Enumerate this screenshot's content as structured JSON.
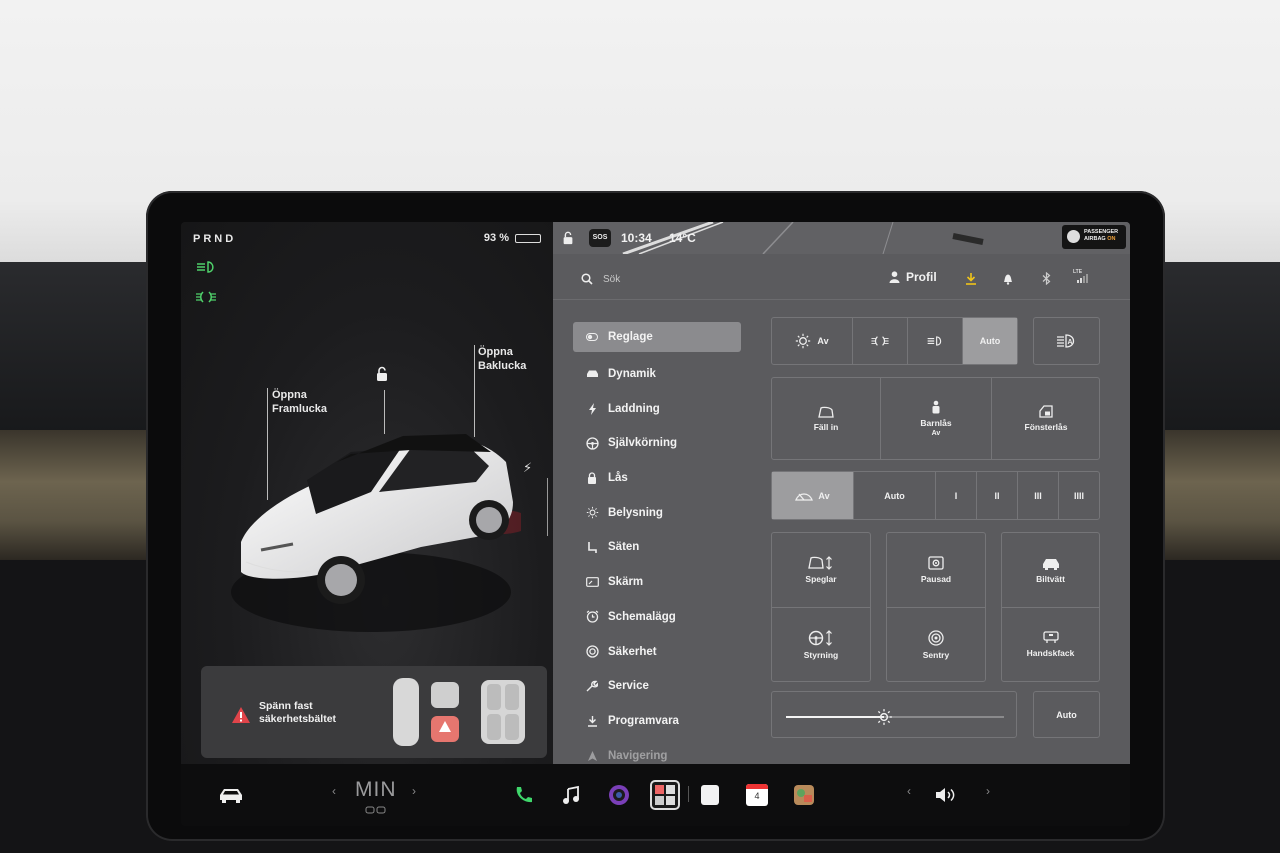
{
  "status": {
    "gear": "PRND",
    "battery_pct": "93 %",
    "battery_level": 0.93,
    "time": "10:34",
    "temperature": "14°C",
    "sos": "SOS"
  },
  "airbag": {
    "line1": "PASSENGER",
    "line2": "AIRBAG",
    "state": "ON"
  },
  "car_view": {
    "front_trunk": "Öppna\nFramlucka",
    "rear_trunk": "Öppna\nBaklucka"
  },
  "alert": {
    "message": "Spänn fast\nsäkerhetsbältet"
  },
  "search": {
    "placeholder": "Sök"
  },
  "profile": {
    "label": "Profil"
  },
  "menu": {
    "items": [
      {
        "label": "Reglage",
        "icon": "toggle-icon"
      },
      {
        "label": "Dynamik",
        "icon": "car-icon"
      },
      {
        "label": "Laddning",
        "icon": "bolt-icon"
      },
      {
        "label": "Självkörning",
        "icon": "steering-wheel-icon"
      },
      {
        "label": "Lås",
        "icon": "lock-icon"
      },
      {
        "label": "Belysning",
        "icon": "sun-icon"
      },
      {
        "label": "Säten",
        "icon": "seat-icon"
      },
      {
        "label": "Skärm",
        "icon": "screen-icon"
      },
      {
        "label": "Schemalägg",
        "icon": "alarm-clock-icon"
      },
      {
        "label": "Säkerhet",
        "icon": "shield-icon"
      },
      {
        "label": "Service",
        "icon": "wrench-icon"
      },
      {
        "label": "Programvara",
        "icon": "download-icon"
      },
      {
        "label": "Navigering",
        "icon": "navigation-icon"
      }
    ]
  },
  "lights": {
    "off": "Av",
    "auto": "Auto"
  },
  "quick": {
    "mirrors_fold": "Fäll in",
    "child_lock": "Barnlås",
    "child_lock_state": "Av",
    "window_lock": "Fönsterlås"
  },
  "wipers": {
    "off": "Av",
    "auto": "Auto",
    "speeds": [
      "I",
      "II",
      "III",
      "IIII"
    ]
  },
  "tiles": {
    "mirrors": "Speglar",
    "dashcam": "Pausad",
    "carwash": "Biltvätt",
    "steering": "Styrning",
    "sentry": "Sentry",
    "glovebox": "Handskfack"
  },
  "brightness": {
    "auto": "Auto",
    "level": 0.45
  },
  "dock": {
    "climate": "MIN",
    "calendar_day": "4"
  }
}
